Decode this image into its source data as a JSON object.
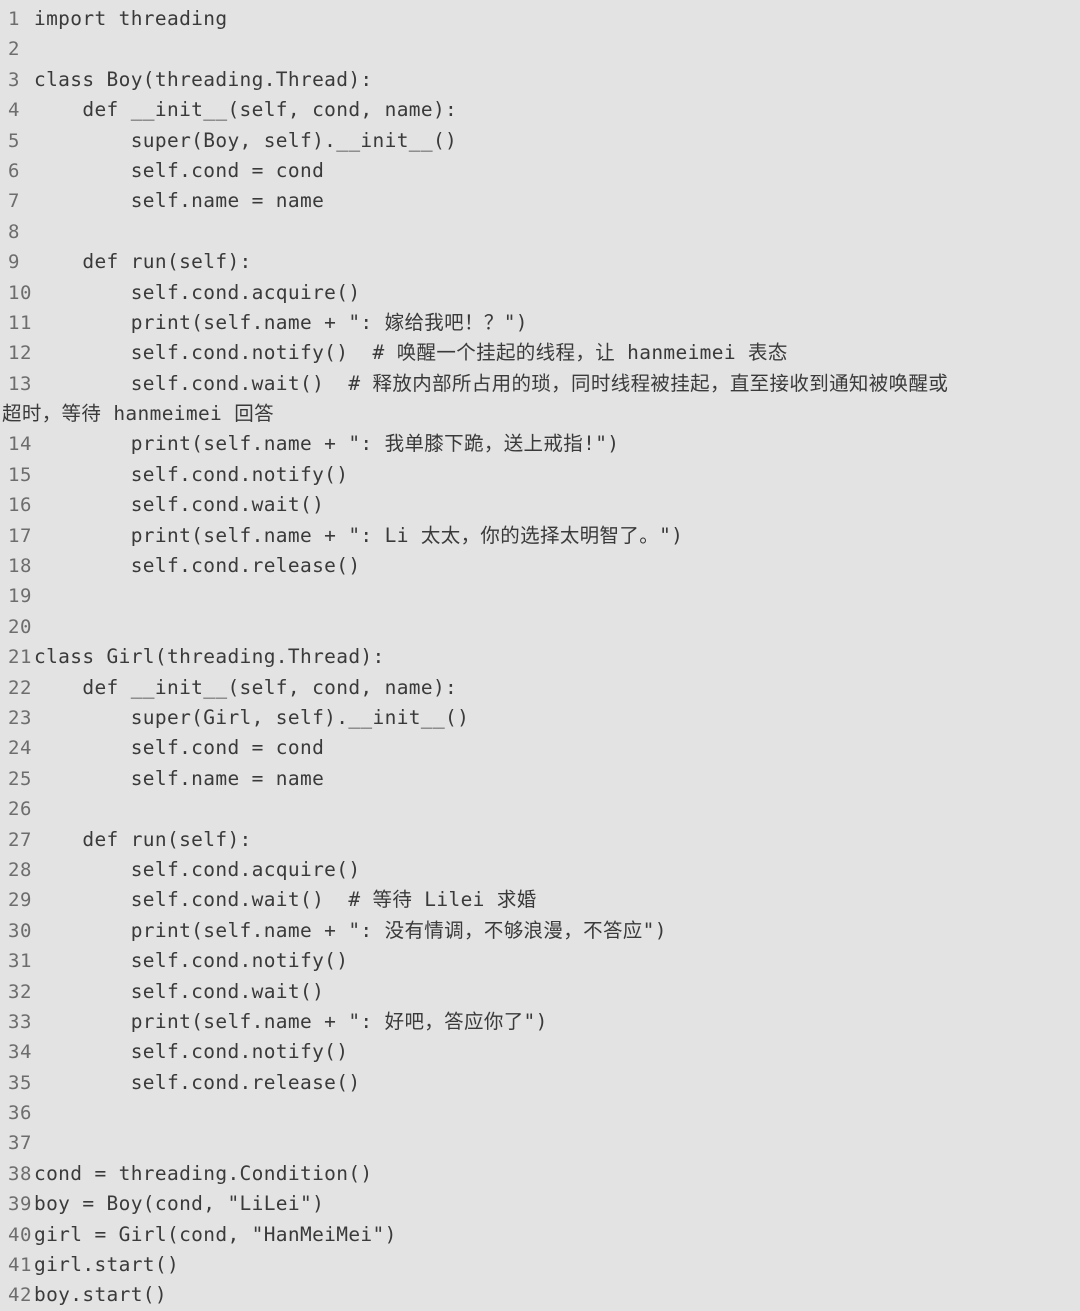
{
  "listing": {
    "language": "python",
    "background_color": "#e3e3e3",
    "text_color": "#3a3a3a",
    "line_number_color": "#6d6d6d",
    "first_line_number": 1,
    "last_line_number": 42,
    "lines": [
      {
        "n": "1",
        "text": "import threading"
      },
      {
        "n": "2",
        "text": ""
      },
      {
        "n": "3",
        "text": "class Boy(threading.Thread):"
      },
      {
        "n": "4",
        "text": "    def __init__(self, cond, name):"
      },
      {
        "n": "5",
        "text": "        super(Boy, self).__init__()"
      },
      {
        "n": "6",
        "text": "        self.cond = cond"
      },
      {
        "n": "7",
        "text": "        self.name = name"
      },
      {
        "n": "8",
        "text": ""
      },
      {
        "n": "9",
        "text": "    def run(self):"
      },
      {
        "n": "10",
        "text": "        self.cond.acquire()"
      },
      {
        "n": "11",
        "text": "        print(self.name + \": 嫁给我吧！？\")"
      },
      {
        "n": "12",
        "text": "        self.cond.notify()  # 唤醒一个挂起的线程，让 hanmeimei 表态"
      },
      {
        "n": "13",
        "text": "        self.cond.wait()  # 释放内部所占用的琐，同时线程被挂起，直至接收到通知被唤醒或"
      },
      {
        "n": "13b",
        "text": "超时，等待 hanmeimei 回答",
        "continuation": true
      },
      {
        "n": "14",
        "text": "        print(self.name + \": 我单膝下跪，送上戒指!\")"
      },
      {
        "n": "15",
        "text": "        self.cond.notify()"
      },
      {
        "n": "16",
        "text": "        self.cond.wait()"
      },
      {
        "n": "17",
        "text": "        print(self.name + \": Li 太太，你的选择太明智了。\")"
      },
      {
        "n": "18",
        "text": "        self.cond.release()"
      },
      {
        "n": "19",
        "text": ""
      },
      {
        "n": "20",
        "text": ""
      },
      {
        "n": "21",
        "text": "class Girl(threading.Thread):"
      },
      {
        "n": "22",
        "text": "    def __init__(self, cond, name):"
      },
      {
        "n": "23",
        "text": "        super(Girl, self).__init__()"
      },
      {
        "n": "24",
        "text": "        self.cond = cond"
      },
      {
        "n": "25",
        "text": "        self.name = name"
      },
      {
        "n": "26",
        "text": ""
      },
      {
        "n": "27",
        "text": "    def run(self):"
      },
      {
        "n": "28",
        "text": "        self.cond.acquire()"
      },
      {
        "n": "29",
        "text": "        self.cond.wait()  # 等待 Lilei 求婚"
      },
      {
        "n": "30",
        "text": "        print(self.name + \": 没有情调，不够浪漫，不答应\")"
      },
      {
        "n": "31",
        "text": "        self.cond.notify()"
      },
      {
        "n": "32",
        "text": "        self.cond.wait()"
      },
      {
        "n": "33",
        "text": "        print(self.name + \": 好吧，答应你了\")"
      },
      {
        "n": "34",
        "text": "        self.cond.notify()"
      },
      {
        "n": "35",
        "text": "        self.cond.release()"
      },
      {
        "n": "36",
        "text": ""
      },
      {
        "n": "37",
        "text": ""
      },
      {
        "n": "38",
        "text": "cond = threading.Condition()"
      },
      {
        "n": "39",
        "text": "boy = Boy(cond, \"LiLei\")"
      },
      {
        "n": "40",
        "text": "girl = Girl(cond, \"HanMeiMei\")"
      },
      {
        "n": "41",
        "text": "girl.start()"
      },
      {
        "n": "42",
        "text": "boy.start()"
      }
    ]
  }
}
